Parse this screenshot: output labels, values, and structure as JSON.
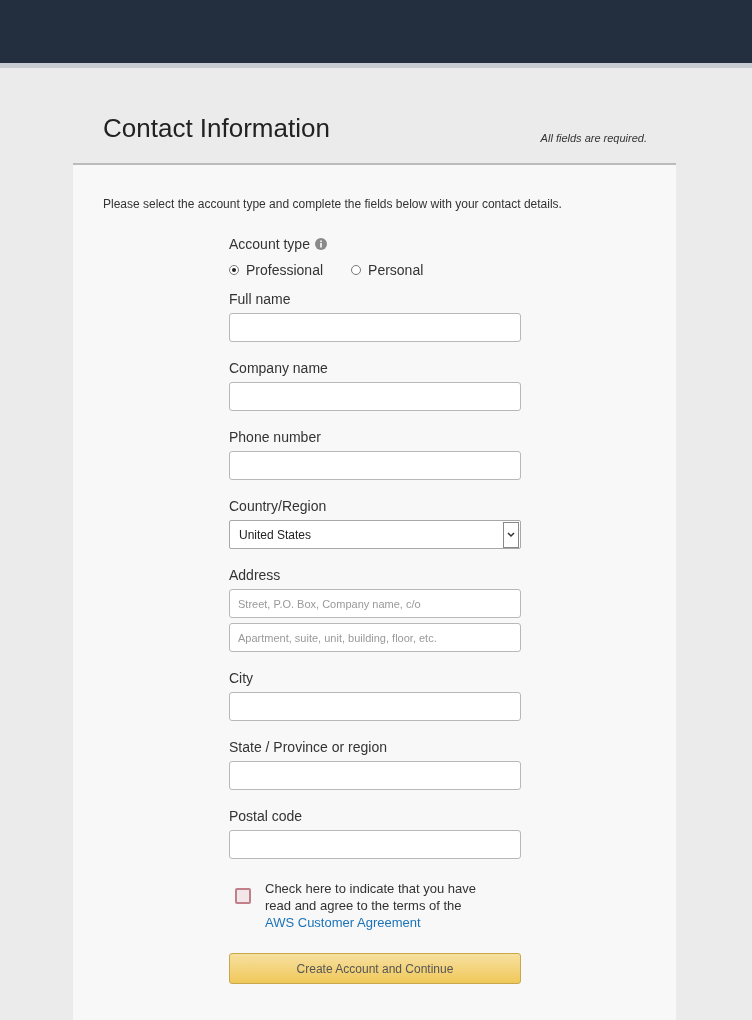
{
  "title": "Contact Information",
  "required_note": "All fields are required.",
  "intro": "Please select the account type and complete the fields below with your contact details.",
  "account_type": {
    "label": "Account type",
    "options": [
      {
        "label": "Professional",
        "selected": true
      },
      {
        "label": "Personal",
        "selected": false
      }
    ]
  },
  "fields": [
    {
      "kind": "text",
      "label": "Full name"
    },
    {
      "kind": "text",
      "label": "Company name"
    },
    {
      "kind": "text",
      "label": "Phone number"
    },
    {
      "kind": "select",
      "label": "Country/Region",
      "value": "United States"
    },
    {
      "kind": "multi",
      "label": "Address",
      "placeholders": [
        "Street, P.O. Box, Company name, c/o",
        "Apartment, suite, unit, building, floor, etc."
      ]
    },
    {
      "kind": "text",
      "label": "City"
    },
    {
      "kind": "text",
      "label": "State / Province or region"
    },
    {
      "kind": "text",
      "label": "Postal code"
    }
  ],
  "agreement": {
    "checked": false,
    "text": "Check here to indicate that you have read and agree to the terms of the",
    "link": "AWS Customer Agreement"
  },
  "submit": "Create Account and Continue"
}
